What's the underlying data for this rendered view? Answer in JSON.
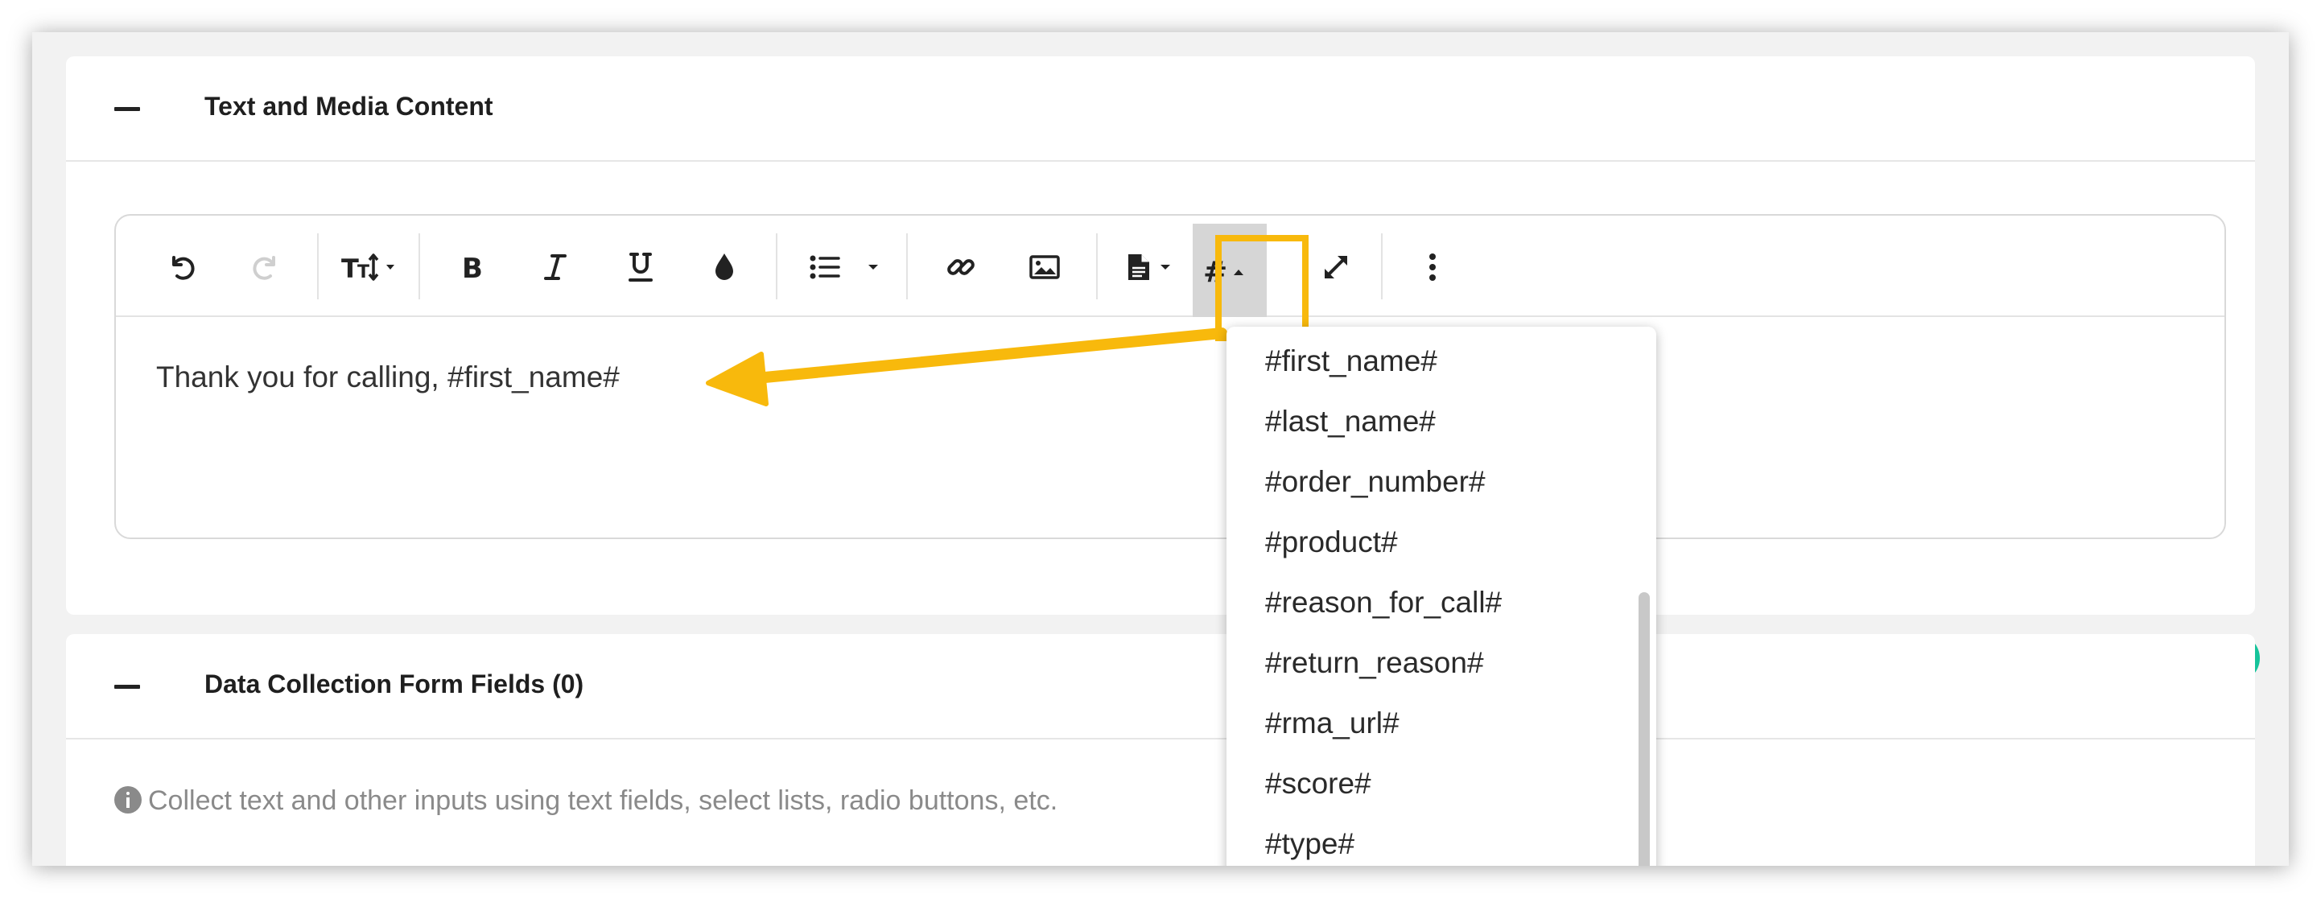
{
  "sections": {
    "text_media": {
      "title": "Text and Media Content"
    },
    "form_fields": {
      "title": "Data Collection Form Fields (0)",
      "hint": "Collect text and other inputs using text fields, select lists, radio buttons, etc."
    }
  },
  "toolbar": {
    "buttons": [
      {
        "name": "undo-button",
        "icon": "undo-icon",
        "enabled": true
      },
      {
        "name": "redo-button",
        "icon": "redo-icon",
        "enabled": false
      },
      {
        "name": "font-size-button",
        "icon": "text-height-icon"
      },
      {
        "name": "bold-button",
        "icon": "bold-icon"
      },
      {
        "name": "italic-button",
        "icon": "italic-icon"
      },
      {
        "name": "underline-button",
        "icon": "underline-icon"
      },
      {
        "name": "color-button",
        "icon": "tint-icon"
      },
      {
        "name": "list-button",
        "icon": "list-icon"
      },
      {
        "name": "link-button",
        "icon": "link-icon"
      },
      {
        "name": "image-button",
        "icon": "image-icon"
      },
      {
        "name": "document-button",
        "icon": "file-icon"
      },
      {
        "name": "merge-field-button",
        "icon": "hash-icon",
        "active": true
      },
      {
        "name": "fullscreen-button",
        "icon": "expand-icon"
      },
      {
        "name": "more-button",
        "icon": "ellipsis-vertical-icon"
      }
    ]
  },
  "editor": {
    "content": "Thank you for calling, #first_name#"
  },
  "merge_fields": [
    "#first_name#",
    "#last_name#",
    "#order_number#",
    "#product#",
    "#reason_for_call#",
    "#return_reason#",
    "#rma_url#",
    "#score#",
    "#type#"
  ],
  "colors": {
    "highlight": "#f8b90c",
    "arrow": "#f8b90c",
    "grammarly": "#15c39a",
    "background": "#f2f2f2"
  }
}
